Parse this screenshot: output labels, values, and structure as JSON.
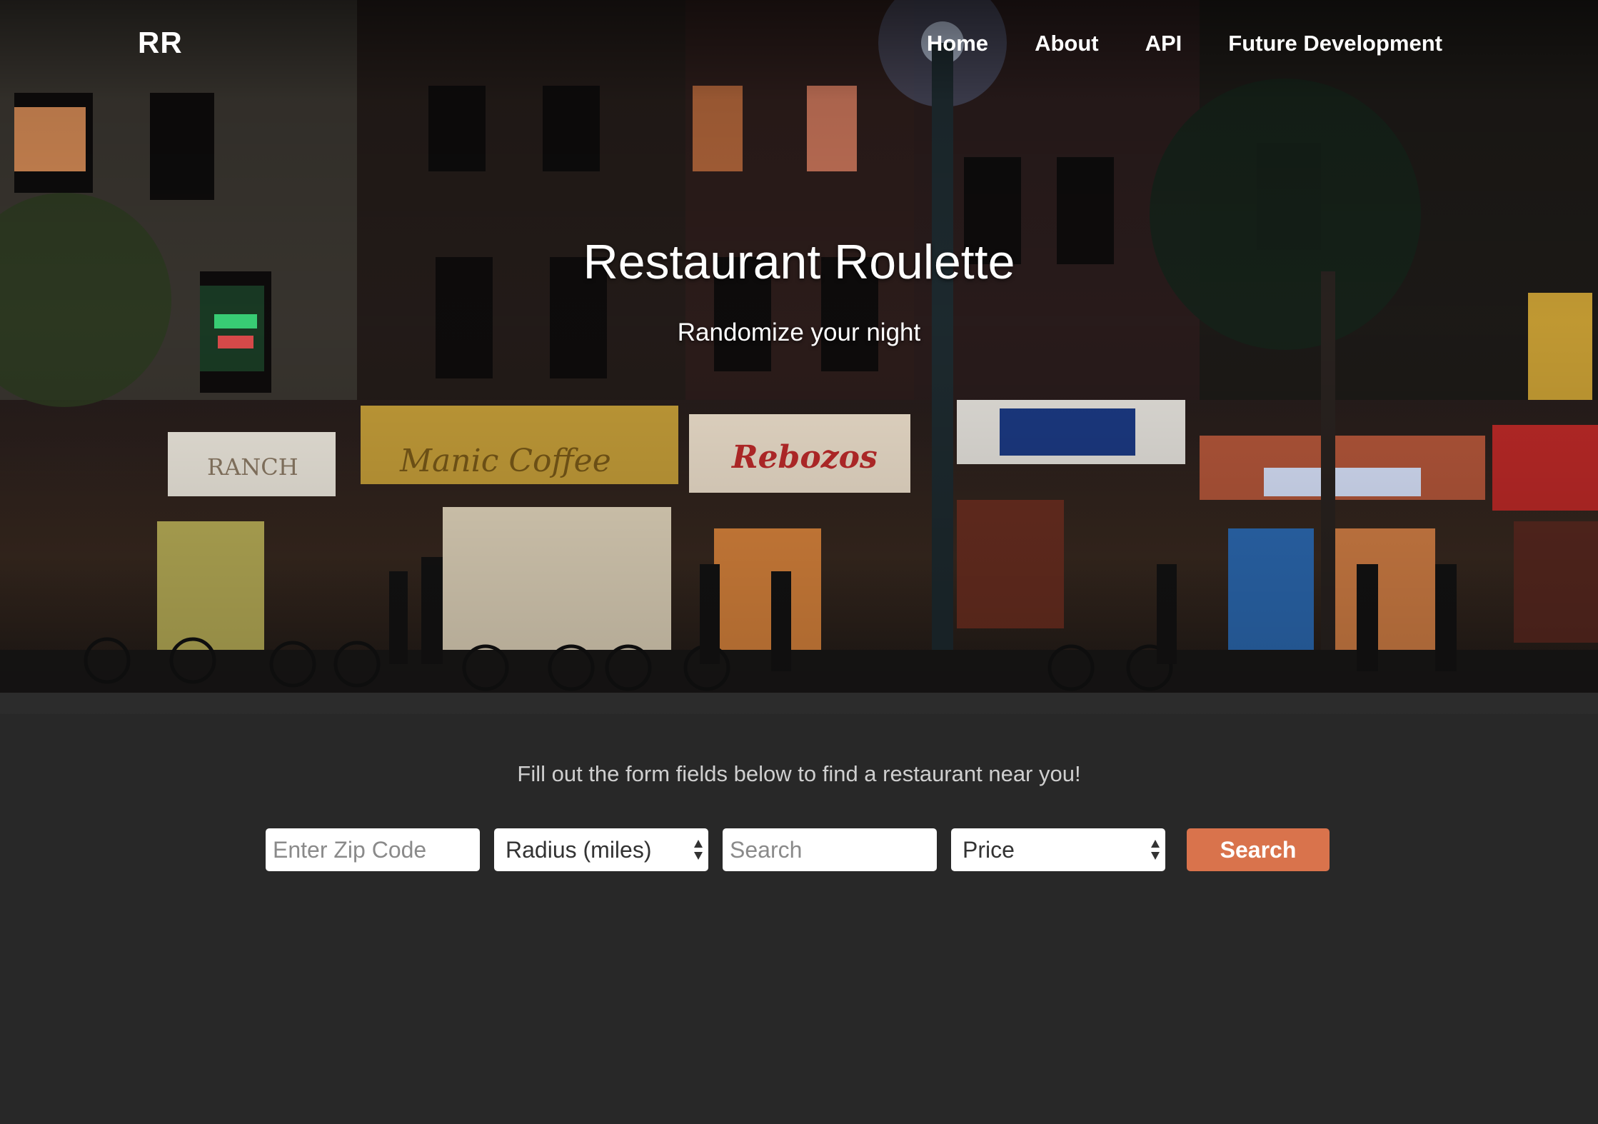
{
  "brand": "RR",
  "nav": {
    "items": [
      "Home",
      "About",
      "API",
      "Future Development"
    ]
  },
  "hero": {
    "title": "Restaurant Roulette",
    "subtitle": "Randomize your night"
  },
  "form": {
    "intro": "Fill out the form fields below to find a restaurant near you!",
    "zip_placeholder": "Enter Zip Code",
    "radius_selected": "Radius (miles)",
    "search_placeholder": "Search",
    "price_selected": "Price",
    "submit_label": "Search"
  },
  "colors": {
    "page_background": "#282828",
    "accent_button": "#d9734c"
  }
}
